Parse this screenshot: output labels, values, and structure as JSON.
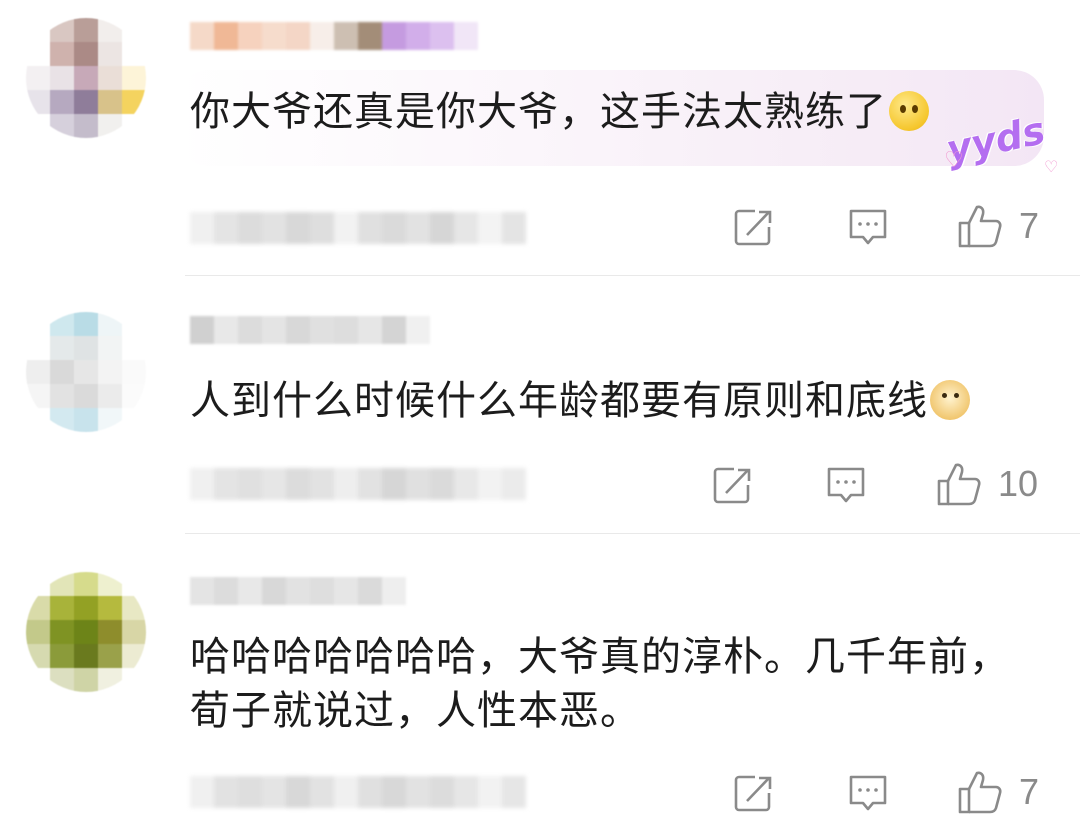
{
  "comments": [
    {
      "text": "你大爷还真是你大爷，这手法太熟练了",
      "emoji": "thinking-face-emoji",
      "sticker": "yyds",
      "likes": "7"
    },
    {
      "text": "人到什么时候什么年龄都要有原则和底线",
      "emoji": "doge-emoji",
      "likes": "10"
    },
    {
      "text": "哈哈哈哈哈哈哈，大爷真的淳朴。几千年前，荀子就说过，人性本恶。",
      "likes": "7"
    }
  ],
  "icons": {
    "share": "share-icon",
    "reply": "reply-icon",
    "like": "thumbs-up-icon"
  },
  "colors": {
    "icon": "#8a8a8a",
    "text": "#1c1c1c",
    "divider": "#e9e9e9",
    "sticker": "#b46ef0"
  }
}
